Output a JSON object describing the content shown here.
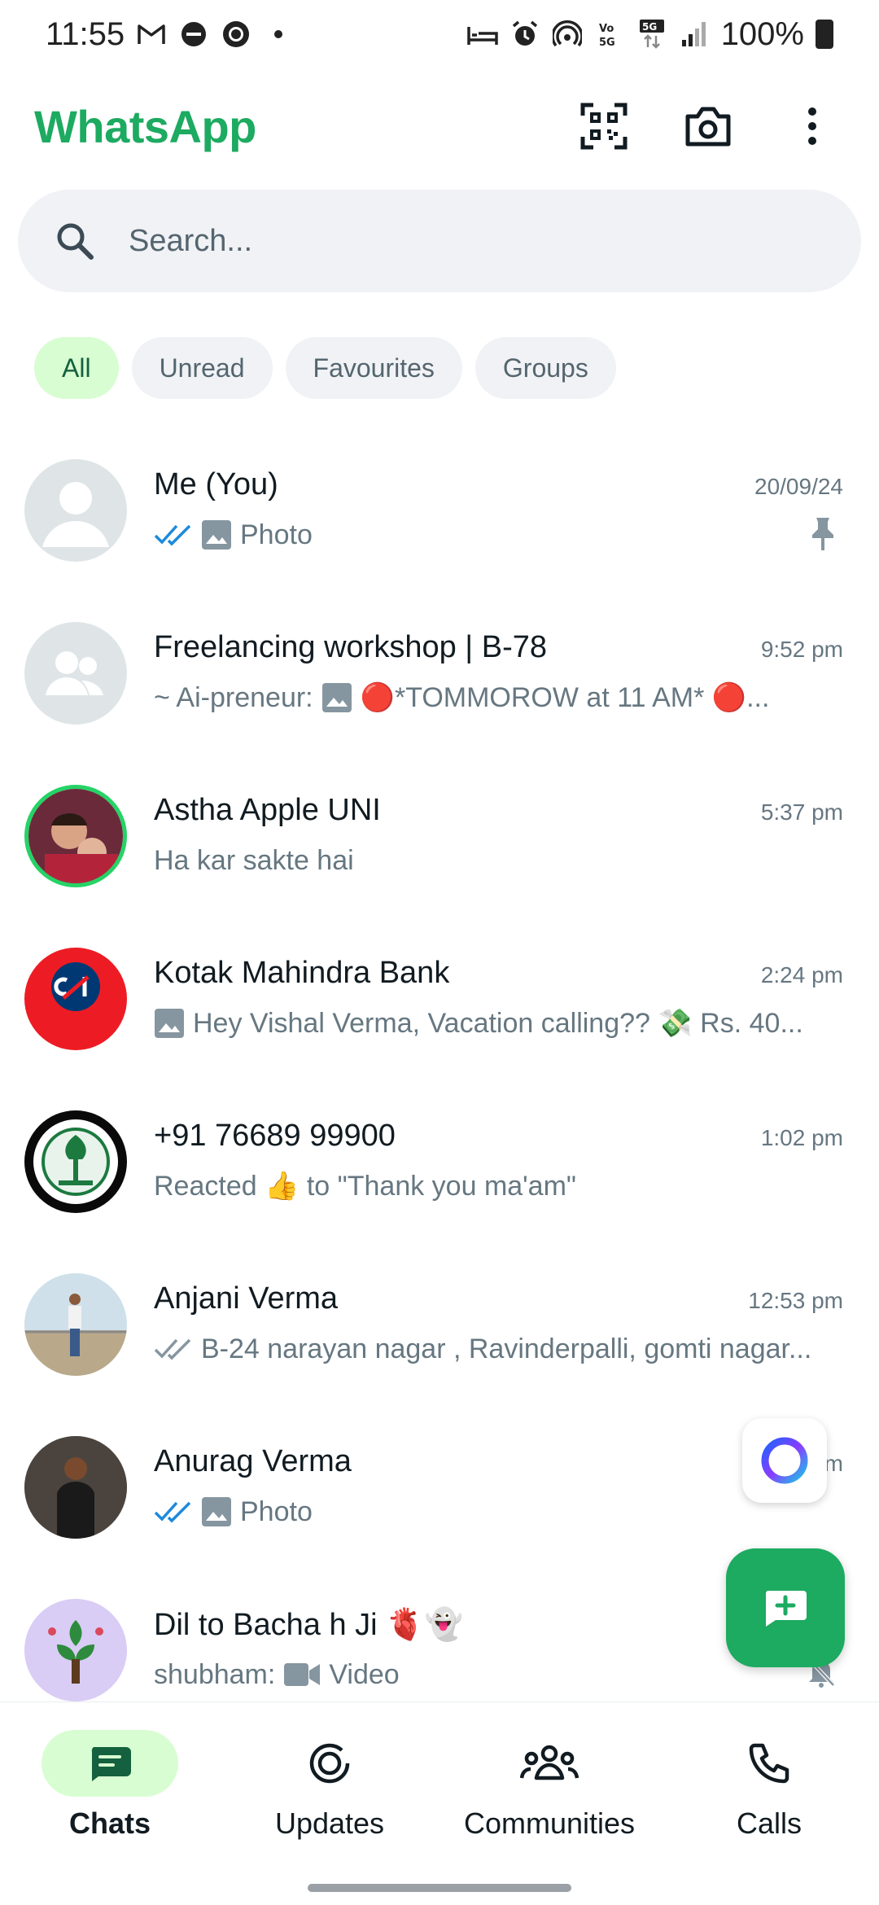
{
  "status_bar": {
    "time": "11:55",
    "battery": "100%"
  },
  "app_bar": {
    "title": "WhatsApp"
  },
  "search": {
    "placeholder": "Search..."
  },
  "filters": [
    {
      "label": "All"
    },
    {
      "label": "Unread"
    },
    {
      "label": "Favourites"
    },
    {
      "label": "Groups"
    }
  ],
  "chats": [
    {
      "name": "Me (You)",
      "time": "20/09/24",
      "preview": "Photo"
    },
    {
      "name": "Freelancing workshop | B-78",
      "time": "9:52 pm",
      "sender": "~ Ai-preneur:",
      "preview": "🔴*TOMMOROW at 11 AM* 🔴..."
    },
    {
      "name": "Astha Apple UNI",
      "time": "5:37 pm",
      "preview": "Ha kar sakte hai"
    },
    {
      "name": "Kotak Mahindra Bank",
      "time": "2:24 pm",
      "preview": "Hey Vishal Verma, Vacation calling?? 💸 Rs. 40..."
    },
    {
      "name": "+91 76689 99900",
      "time": "1:02 pm",
      "preview": "Reacted 👍 to \"Thank you ma'am\""
    },
    {
      "name": "Anjani Verma",
      "time": "12:53 pm",
      "preview": "B-24 narayan nagar , Ravinderpalli, gomti nagar..."
    },
    {
      "name": "Anurag Verma",
      "time": "m",
      "preview": "Photo"
    },
    {
      "name": "Dil to Bacha h Ji 🫀👻",
      "time": "",
      "sender": "shubham:",
      "preview": "Video"
    }
  ],
  "nav": [
    {
      "label": "Chats"
    },
    {
      "label": "Updates"
    },
    {
      "label": "Communities"
    },
    {
      "label": "Calls"
    }
  ],
  "colors": {
    "brand": "#1daa61",
    "chip_active_bg": "#d8fdd2",
    "read_tick": "#1c8adb"
  }
}
